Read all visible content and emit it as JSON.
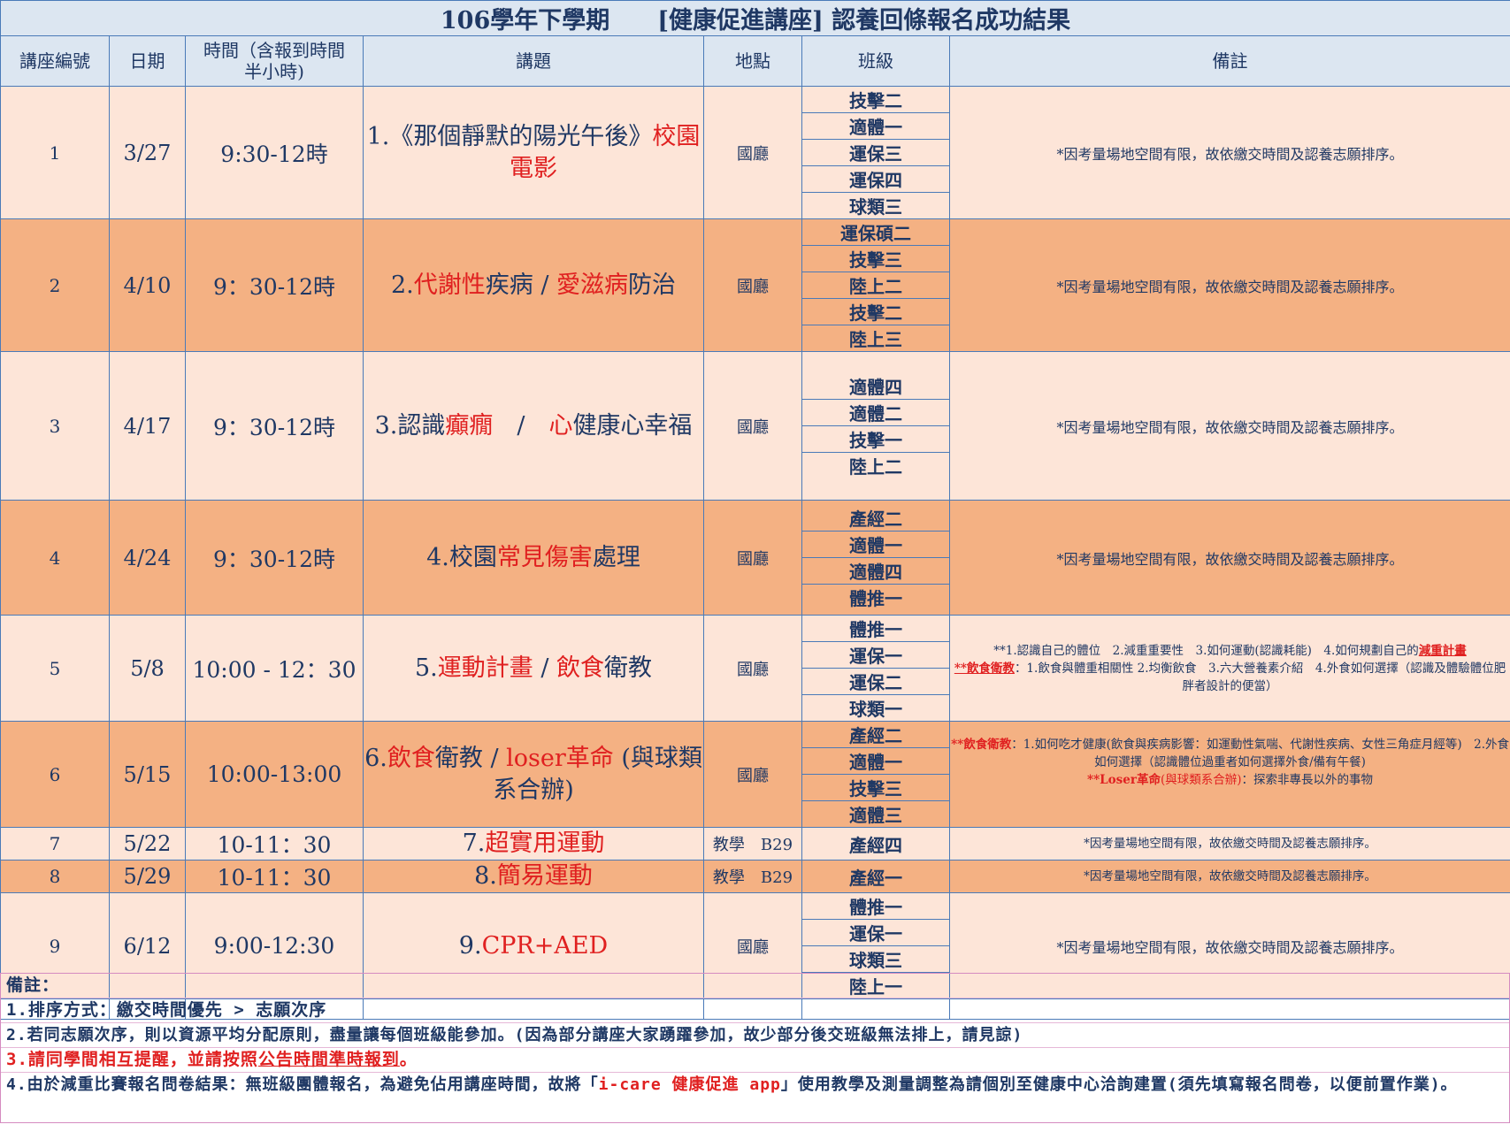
{
  "title": "106學年下學期　　[健康促進講座]  認養回條報名成功結果",
  "headers": {
    "no": "講座編號",
    "date": "日期",
    "time": "時間（含報到時間半小時)",
    "topic": "講題",
    "location": "地點",
    "class": "班級",
    "note": "備註"
  },
  "rows": [
    {
      "no": "1",
      "date": "3/27",
      "time": "9:30-12時",
      "topic_parts": [
        {
          "t": "1.《那個靜默的陽光午後》",
          "red": false
        },
        {
          "t": "校園電影",
          "red": true
        }
      ],
      "location": "國廳",
      "classes": [
        "技擊二",
        "適體一",
        "運保三",
        "運保四",
        "球類三"
      ],
      "note": "*因考量場地空間有限，故依繳交時間及認養志願排序。"
    },
    {
      "no": "2",
      "date": "4/10",
      "time": "9：30-12時",
      "topic_parts": [
        {
          "t": "2.",
          "red": false
        },
        {
          "t": "代謝性",
          "red": true
        },
        {
          "t": "疾病 / ",
          "red": false
        },
        {
          "t": "愛滋病",
          "red": true
        },
        {
          "t": "防治",
          "red": false
        }
      ],
      "location": "國廳",
      "classes": [
        "運保碩二",
        "技擊三",
        "陸上二",
        "技擊二",
        "陸上三"
      ],
      "note": "*因考量場地空間有限，故依繳交時間及認養志願排序。"
    },
    {
      "no": "3",
      "date": "4/17",
      "time": "9：30-12時",
      "topic_parts": [
        {
          "t": "3.認識",
          "red": false
        },
        {
          "t": "癲癇",
          "red": true
        },
        {
          "t": "　/　",
          "red": false
        },
        {
          "t": "心",
          "red": true
        },
        {
          "t": "健康心幸福",
          "red": false
        }
      ],
      "location": "國廳",
      "classes": [
        "適體四",
        "適體二",
        "技擊一",
        "陸上二"
      ],
      "note": "*因考量場地空間有限，故依繳交時間及認養志願排序。"
    },
    {
      "no": "4",
      "date": "4/24",
      "time": "9：30-12時",
      "topic_parts": [
        {
          "t": "4.校園",
          "red": false
        },
        {
          "t": "常見傷害",
          "red": true
        },
        {
          "t": "處理",
          "red": false
        }
      ],
      "location": "國廳",
      "classes": [
        "產經二",
        "適體一",
        "適體四",
        "體推一"
      ],
      "note": "*因考量場地空間有限，故依繳交時間及認養志願排序。"
    },
    {
      "no": "5",
      "date": "5/8",
      "time": "10:00 - 12：30",
      "topic_parts": [
        {
          "t": "5.",
          "red": false
        },
        {
          "t": "運動計畫",
          "red": true
        },
        {
          "t": " / ",
          "red": false
        },
        {
          "t": "飲食",
          "red": true
        },
        {
          "t": "衛教",
          "red": false
        }
      ],
      "location": "國廳",
      "classes": [
        "體推一",
        "運保一",
        "運保二",
        "球類一"
      ],
      "note_lines": [
        "**1.認識自己的體位　2.減重重要性　3.如何運動(認識耗能)　4.如何規劃自己的",
        "減重計畫",
        "**飲食衛教",
        "：1.飲食與體重相關性 2.均衡飲食　3.六大營養素介紹　4.外食如何選擇（認識及體驗體位肥胖者設計的便當）"
      ]
    },
    {
      "no": "6",
      "date": "5/15",
      "time": "10:00-13:00",
      "topic_parts": [
        {
          "t": "6.",
          "red": false
        },
        {
          "t": "飲食",
          "red": true
        },
        {
          "t": "衛教 / ",
          "red": false
        },
        {
          "t": "loser革命",
          "red": true
        },
        {
          "t": " (與球類系合辦)",
          "red": false
        }
      ],
      "location": "國廳",
      "classes": [
        "產經二",
        "適體一",
        "技擊三",
        "適體三"
      ],
      "note_lines": [
        "**飲食衛教",
        "：1.如何吃才健康(飲食與疾病影響：如運動性氣喘、代謝性疾病、女性三角症月經等)　2.外食如何選擇（認識體位過重者如何選擇外食/備有午餐)",
        "**Loser革命",
        "(與球類系合辦)",
        "：探索非專長以外的事物"
      ]
    },
    {
      "no": "7",
      "date": "5/22",
      "time": "10-11：30",
      "topic_parts": [
        {
          "t": "7.",
          "red": false
        },
        {
          "t": "超實用運動",
          "red": true
        }
      ],
      "location": "教學　B29",
      "classes": [
        "產經四"
      ],
      "note": "*因考量場地空間有限，故依繳交時間及認養志願排序。"
    },
    {
      "no": "8",
      "date": "5/29",
      "time": "10-11：30",
      "topic_parts": [
        {
          "t": "8.",
          "red": false
        },
        {
          "t": "簡易運動",
          "red": true
        }
      ],
      "location": "教學　B29",
      "classes": [
        "產經一"
      ],
      "note": "*因考量場地空間有限，故依繳交時間及認養志願排序。"
    },
    {
      "no": "9",
      "date": "6/12",
      "time": "9:00-12:30",
      "topic_parts": [
        {
          "t": "9.",
          "red": false
        },
        {
          "t": "CPR+AED",
          "red": true
        }
      ],
      "location": "國廳",
      "classes": [
        "體推一",
        "運保一",
        "球類三",
        "陸上一"
      ],
      "note": "*因考量場地空間有限，故依繳交時間及認養志願排序。"
    }
  ],
  "footer": {
    "heading": "備註：",
    "line1": "1.排序方式：繳交時間優先 > 志願次序",
    "line2": "2.若同志願次序，則以資源平均分配原則，盡量讓每個班級能參加。(因為部分講座大家踴躍參加，故少部分後交班級無法排上，請見諒)",
    "line3_a": "3.請同學間相互提醒，並請按照",
    "line3_b": "公告時間準時報到",
    "line3_c": "。",
    "line4_a": "4.由於減重比賽報名問卷結果：無班級團體報名，為避免佔用講座時間，故將「",
    "line4_b": "i-care 健康促進 app",
    "line4_c": "」使用教學及測量調整為請個別至健康中心洽詢建置(須先填寫報名問卷，以便前置作業)。"
  },
  "colors": {
    "light_row": "#fde5d8",
    "dark_row": "#f4b183",
    "header_bg": "#dce6f1",
    "text_navy": "#1f3864",
    "accent_red": "#e02020",
    "border_blue": "#4a7ab8"
  }
}
